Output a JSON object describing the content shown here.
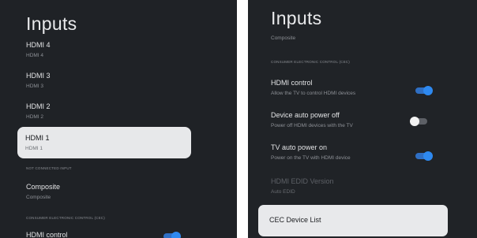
{
  "left": {
    "title": "Inputs",
    "items": [
      {
        "label": "HDMI 4",
        "sub": "HDMI 4"
      },
      {
        "label": "HDMI 3",
        "sub": "HDMI 3"
      },
      {
        "label": "HDMI 2",
        "sub": "HDMI 2"
      },
      {
        "label": "HDMI 1",
        "sub": "HDMI 1"
      }
    ],
    "not_connected_header": "NOT CONNECTED INPUT",
    "composite": {
      "label": "Composite",
      "sub": "Composite"
    },
    "cec_header": "CONSUMER ELECTRONIC CONTROL (CEC)",
    "hdmi_control": {
      "label": "HDMI control"
    }
  },
  "right": {
    "title": "Inputs",
    "composite_sub": "Composite",
    "cec_header": "CONSUMER ELECTRONIC CONTROL (CEC)",
    "hdmi_control": {
      "label": "HDMI control",
      "sub": "Allow the TV to control HDMI devices",
      "state": "on"
    },
    "device_auto_power_off": {
      "label": "Device auto power off",
      "sub": "Power off HDMI devices with the TV",
      "state": "off"
    },
    "tv_auto_power_on": {
      "label": "TV auto power on",
      "sub": "Power on the TV with HDMI device",
      "state": "on"
    },
    "edid": {
      "label": "HDMI EDID Version",
      "sub": "Auto EDID"
    },
    "cec_device_list": "CEC Device List"
  },
  "colors": {
    "panel_bg": "#1f2226",
    "focus_bg": "#e7e8ea",
    "toggle_on": "#2e89f0",
    "toggle_off": "#f2f2f2"
  }
}
